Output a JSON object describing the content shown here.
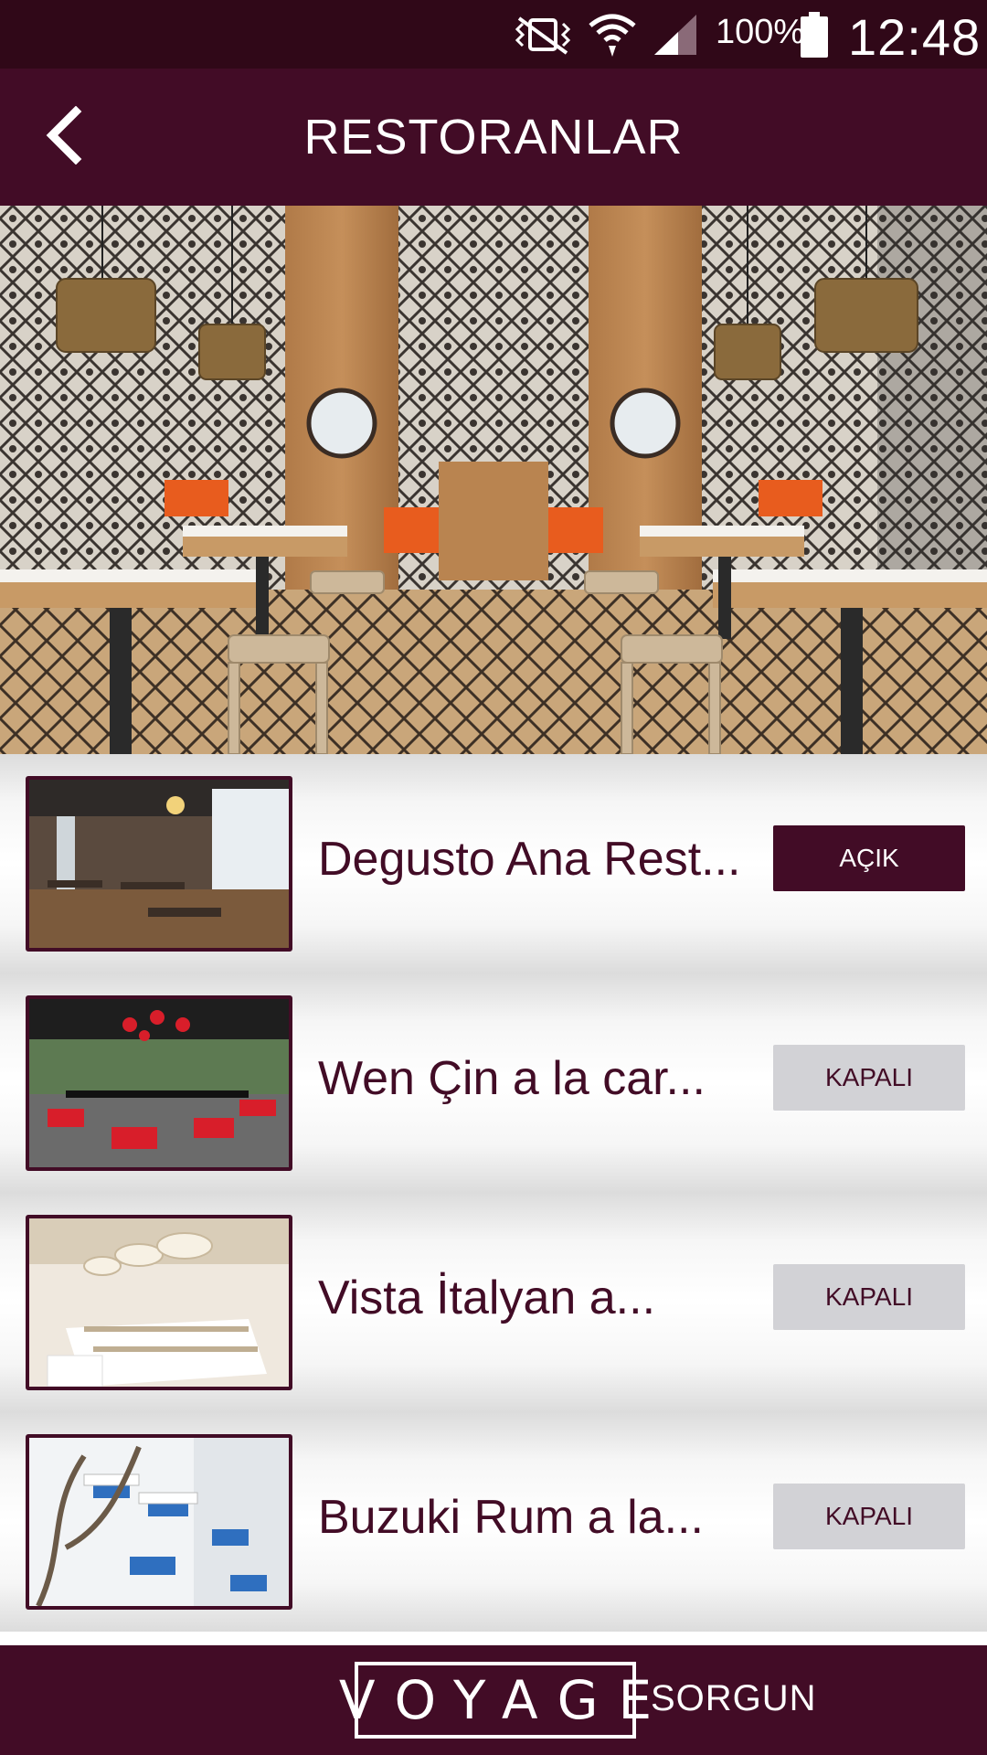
{
  "status_bar": {
    "battery_percent": "100%",
    "time": "12:48",
    "icons": [
      "vibrate-mute-icon",
      "wifi-icon",
      "signal-icon",
      "battery-icon"
    ]
  },
  "app_bar": {
    "title": "RESTORANLAR",
    "back_icon": "chevron-left-icon"
  },
  "hero": {
    "image": "restaurant-interior-photo"
  },
  "restaurants": [
    {
      "name": "Degusto Ana Rest...",
      "status": "AÇIK",
      "open": true,
      "thumb": "restaurant-photo"
    },
    {
      "name": "Wen Çin a la car...",
      "status": "KAPALI",
      "open": false,
      "thumb": "restaurant-photo"
    },
    {
      "name": "Vista İtalyan a...",
      "status": "KAPALI",
      "open": false,
      "thumb": "restaurant-photo"
    },
    {
      "name": "Buzuki Rum a la...",
      "status": "KAPALI",
      "open": false,
      "thumb": "restaurant-photo"
    }
  ],
  "footer": {
    "logo": "VOYAGE",
    "location": "SORGUN"
  },
  "colors": {
    "primary": "#420c26",
    "status_bar": "#300818",
    "closed_badge": "#d2d2d6",
    "text_on_primary": "#ffffff"
  }
}
